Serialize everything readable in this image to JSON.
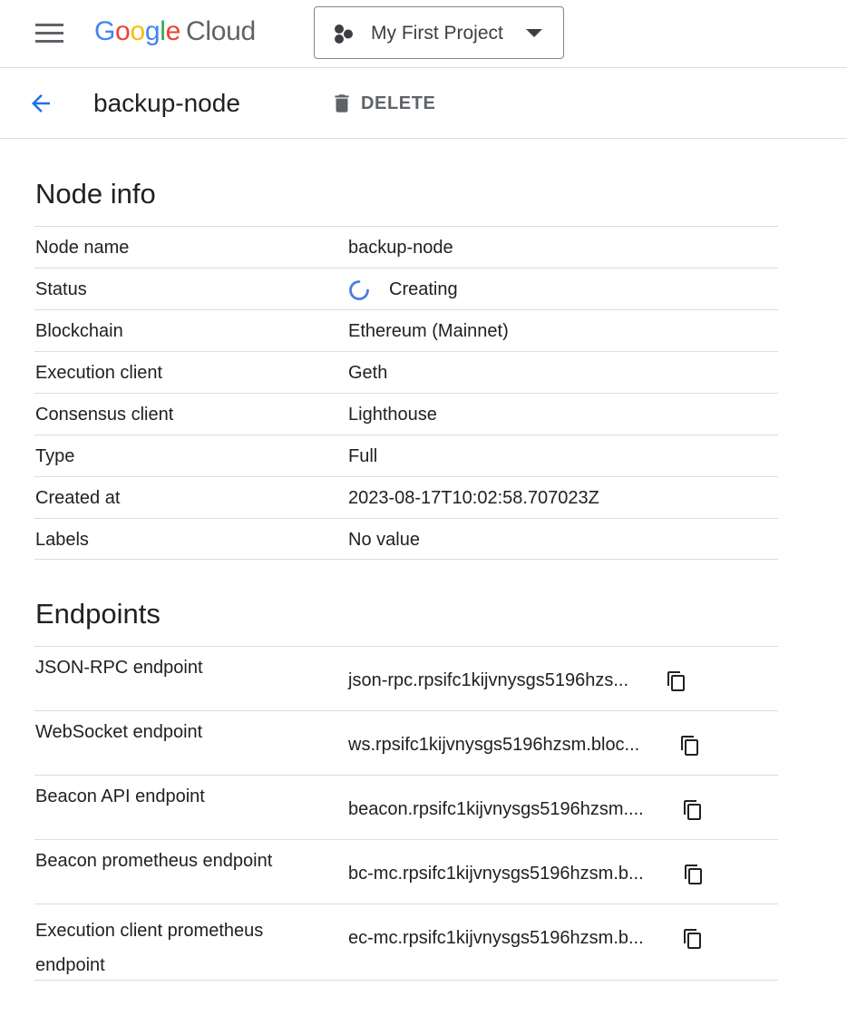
{
  "header": {
    "logo": [
      "G",
      "o",
      "o",
      "g",
      "l",
      "e"
    ],
    "logo_product": "Cloud",
    "project_name": "My First Project"
  },
  "subheader": {
    "node_title": "backup-node",
    "delete_label": "DELETE"
  },
  "node_info": {
    "title": "Node info",
    "rows": [
      {
        "label": "Node name",
        "value": "backup-node"
      },
      {
        "label": "Status",
        "value": "Creating"
      },
      {
        "label": "Blockchain",
        "value": "Ethereum (Mainnet)"
      },
      {
        "label": "Execution client",
        "value": "Geth"
      },
      {
        "label": "Consensus client",
        "value": "Lighthouse"
      },
      {
        "label": "Type",
        "value": "Full"
      },
      {
        "label": "Created at",
        "value": "2023-08-17T10:02:58.707023Z"
      },
      {
        "label": "Labels",
        "value": "No value"
      }
    ]
  },
  "endpoints": {
    "title": "Endpoints",
    "rows": [
      {
        "label": "JSON-RPC endpoint",
        "value": "json-rpc.rpsifc1kijvnysgs5196hzs..."
      },
      {
        "label": "WebSocket endpoint",
        "value": "ws.rpsifc1kijvnysgs5196hzsm.bloc..."
      },
      {
        "label": "Beacon API endpoint",
        "value": "beacon.rpsifc1kijvnysgs5196hzsm...."
      },
      {
        "label": "Beacon prometheus endpoint",
        "value": "bc-mc.rpsifc1kijvnysgs5196hzsm.b..."
      },
      {
        "label": "Execution client prometheus endpoint",
        "value": "ec-mc.rpsifc1kijvnysgs5196hzsm.b..."
      }
    ]
  },
  "colors": {
    "google_blue": "#4285F4",
    "google_red": "#EA4335",
    "google_yellow": "#FBBC05",
    "google_green": "#34A853",
    "icon_grey": "#5f6368",
    "divider": "#dadce0"
  },
  "icons": {
    "menu": "hamburger-menu-icon",
    "project": "project-hexagon-icon",
    "dropdown": "caret-down-icon",
    "back": "arrow-back-icon",
    "delete": "trash-icon",
    "status": "loading-spinner-icon",
    "copy": "copy-icon"
  }
}
